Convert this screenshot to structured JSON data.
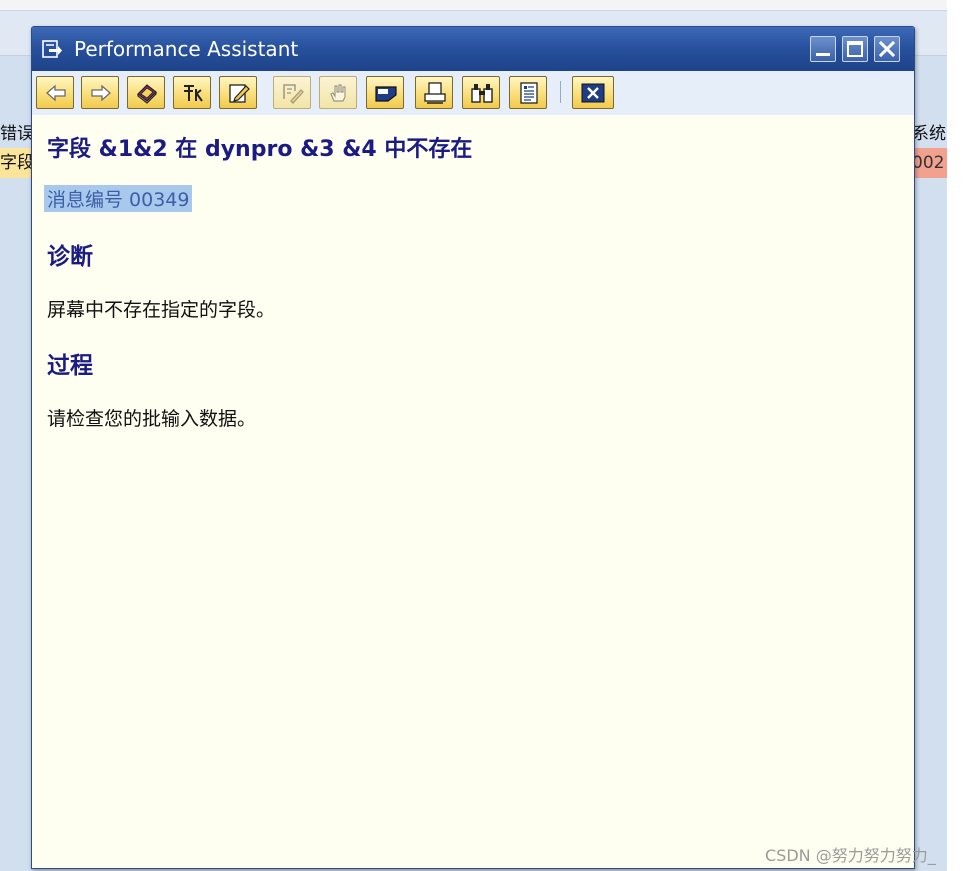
{
  "background": {
    "left_header": "错误",
    "left_cell": "字段",
    "right_header": "系统",
    "right_cell": "002"
  },
  "dialog": {
    "title": "Performance Assistant",
    "window_buttons": [
      "minimize",
      "maximize",
      "close"
    ]
  },
  "toolbar": {
    "buttons": [
      {
        "icon": "back-arrow-icon",
        "enabled": true
      },
      {
        "icon": "forward-arrow-icon",
        "enabled": true
      },
      {
        "icon": "book-icon",
        "enabled": true
      },
      {
        "icon": "technical-info-icon",
        "enabled": true
      },
      {
        "icon": "edit-icon",
        "enabled": true
      },
      {
        "icon": "glossary-icon",
        "enabled": false
      },
      {
        "icon": "hand-pointer-icon",
        "enabled": false
      },
      {
        "icon": "display-icon",
        "enabled": true
      },
      {
        "icon": "print-icon",
        "enabled": true
      },
      {
        "icon": "find-icon",
        "enabled": true
      },
      {
        "icon": "document-icon",
        "enabled": true
      },
      {
        "icon": "exit-icon",
        "enabled": true
      }
    ]
  },
  "content": {
    "title": "字段 &1&2 在 dynpro &3 &4 中不存在",
    "message_number": "消息编号 00349",
    "sections": [
      {
        "heading": "诊断",
        "text": "屏幕中不存在指定的字段。"
      },
      {
        "heading": "过程",
        "text": "请检查您的批输入数据。"
      }
    ]
  },
  "watermark": "CSDN @努力努力努力_",
  "colors": {
    "titlebar": "#27509c",
    "content_bg": "#fefff0",
    "heading": "#1b1b83",
    "toolbar_button": "#f9df7a",
    "selection": "#a8c8ec"
  }
}
